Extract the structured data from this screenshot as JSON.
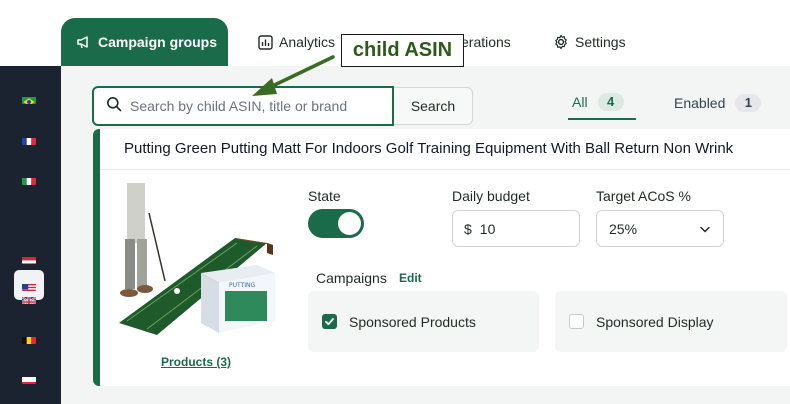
{
  "topnav": {
    "tabs": [
      {
        "label": "Campaign groups",
        "icon": "megaphone-icon",
        "active": true
      },
      {
        "label": "Analytics",
        "icon": "bar-chart-icon",
        "active": false
      },
      {
        "label": "erations",
        "icon": "",
        "active": false
      },
      {
        "label": "Settings",
        "icon": "gear-icon",
        "active": false
      }
    ]
  },
  "sidebar": {
    "flags": [
      "brazil-flag-icon",
      "france-flag-icon",
      "italy-flag-icon",
      "usa-flag-icon",
      "egypt-flag-icon",
      "uk-flag-icon",
      "belgium-flag-icon",
      "poland-flag-icon"
    ],
    "active_flag": "usa-flag-icon"
  },
  "search": {
    "placeholder": "Search by child ASIN, title or brand",
    "value": "",
    "button_label": "Search"
  },
  "filters": {
    "all_label": "All",
    "all_count": "4",
    "enabled_label": "Enabled",
    "enabled_count": "1"
  },
  "card": {
    "title": "Putting Green Putting Matt For Indoors Golf Training Equipment With Ball Return Non Wrink",
    "products_link": "Products (3)",
    "state_label": "State",
    "state_enabled": true,
    "daily_budget_label": "Daily budget",
    "currency": "$",
    "daily_budget_value": "10",
    "target_acos_label": "Target ACoS %",
    "target_acos_value": "25%",
    "campaigns_label": "Campaigns",
    "edit_label": "Edit",
    "campaigns": [
      {
        "label": "Sponsored Products",
        "checked": true
      },
      {
        "label": "Sponsored Display",
        "checked": false
      }
    ]
  },
  "annotation": {
    "label": "child ASIN",
    "color": "#2d5a1b"
  },
  "colors": {
    "brand": "#1a6b4a",
    "sidebar": "#1b2230"
  }
}
